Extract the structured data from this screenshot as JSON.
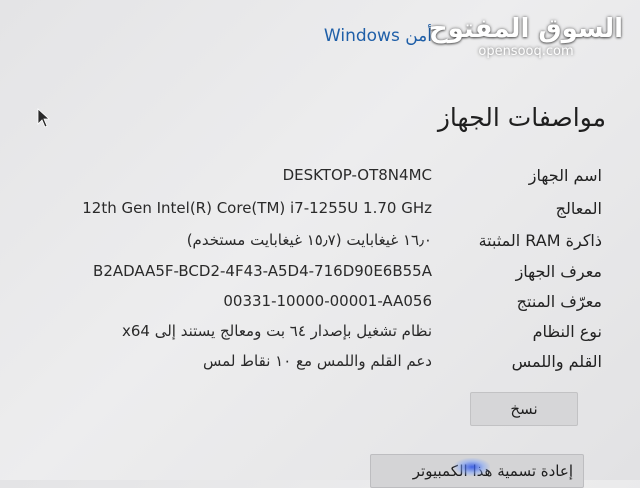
{
  "header": {
    "link_text": "أمن Windows"
  },
  "watermark": {
    "arabic": "السوق المفتوح",
    "latin": "opensooq.com"
  },
  "section": {
    "title": "مواصفات الجهاز"
  },
  "specs": [
    {
      "label": "اسم الجهاز",
      "value": "DESKTOP-OT8N4MC"
    },
    {
      "label": "المعالج",
      "value": "12th Gen Intel(R) Core(TM) i7-1255U   1.70 GHz"
    },
    {
      "label": "ذاكرة RAM المثبتة",
      "value": "١٦٫٠ غيغابايت (١٥٫٧ غيغابايت مستخدم)"
    },
    {
      "label": "معرف الجهاز",
      "value": "B2ADAA5F-BCD2-4F43-A5D4-716D90E6B55A"
    },
    {
      "label": "معرّف المنتج",
      "value": "00331-10000-00001-AA056"
    },
    {
      "label": "نوع النظام",
      "value": "نظام تشغيل بإصدار ٦٤ بت ومعالج يستند إلى x64"
    },
    {
      "label": "القلم واللمس",
      "value": "دعم القلم واللمس مع ١٠ نقاط لمس"
    }
  ],
  "buttons": {
    "copy": "نسخ",
    "rename": "إعادة تسمية هذا الكمبيوتر"
  },
  "colors": {
    "link": "#1f5fa8",
    "background": "#e8e8ea",
    "button": "#d6d6d8"
  }
}
